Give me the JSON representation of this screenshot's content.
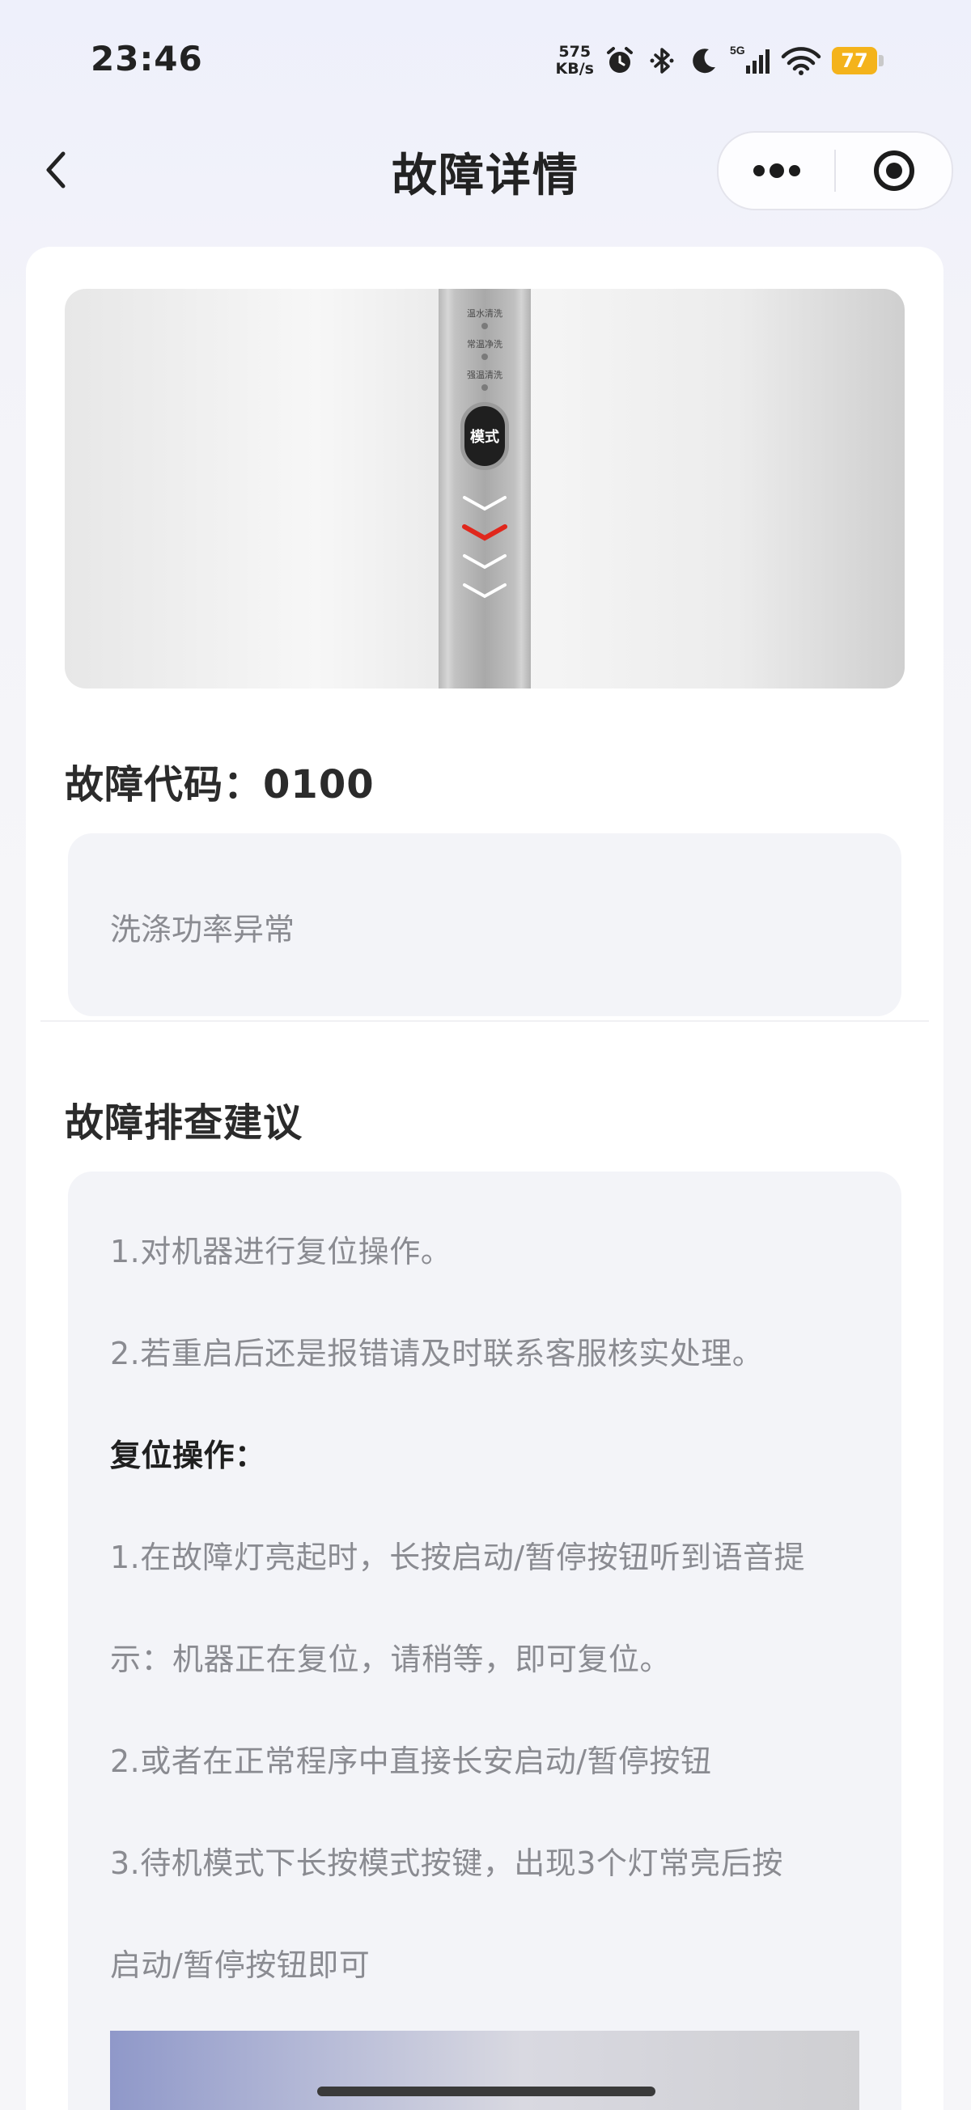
{
  "status_bar": {
    "time": "23:46",
    "net_speed_value": "575",
    "net_speed_unit": "KB/s",
    "network_type": "5G",
    "battery_level": "77",
    "battery_color": "#f4b31b",
    "icons": [
      "alarm-icon",
      "bluetooth-icon",
      "moon-icon",
      "signal-icon",
      "wifi-icon",
      "battery-icon"
    ]
  },
  "nav": {
    "title": "故障详情",
    "back_icon": "chevron-left-icon",
    "capsule_icons": [
      "more-icon",
      "close-target-icon"
    ]
  },
  "fault": {
    "code_label": "故障代码：",
    "code_value": "0100",
    "description": "洗涤功率异常"
  },
  "device_panel": {
    "labels": [
      "温水清洗",
      "常温净洗",
      "强温清洗"
    ],
    "mode_button": "模式",
    "chevrons": [
      "white",
      "red",
      "white",
      "white"
    ],
    "accent": "#e0271c"
  },
  "troubleshooting": {
    "title": "故障排查建议",
    "lines": [
      "1.对机器进行复位操作。",
      "2.若重启后还是报错请及时联系客服核实处理。",
      "复位操作：",
      "1.在故障灯亮起时，长按启动/暂停按钮听到语音提",
      "示：机器正在复位，请稍等，即可复位。",
      "2.或者在正常程序中直接长安启动/暂停按钮",
      "3.待机模式下长按模式按键，出现3个灯常亮后按",
      "启动/暂停按钮即可"
    ]
  }
}
